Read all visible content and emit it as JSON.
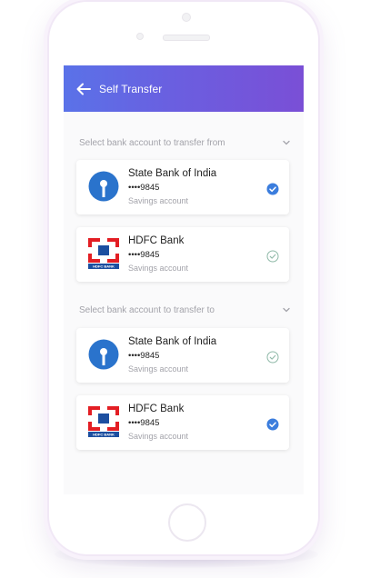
{
  "header": {
    "title": "Self Transfer"
  },
  "from_section": {
    "label": "Select  bank account to transfer from",
    "accounts": [
      {
        "bank": "State Bank of India",
        "number": "••••9845",
        "type": "Savings account",
        "selected": true,
        "logo": "sbi-logo"
      },
      {
        "bank": "HDFC Bank",
        "number": "••••9845",
        "type": "Savings account",
        "selected": false,
        "logo": "hdfc-logo",
        "logo_text": "HDFC BANK"
      }
    ]
  },
  "to_section": {
    "label": "Select  bank account to transfer to",
    "accounts": [
      {
        "bank": "State Bank of India",
        "number": "••••9845",
        "type": "Savings account",
        "selected": false,
        "logo": "sbi-logo"
      },
      {
        "bank": "HDFC Bank",
        "number": "••••9845",
        "type": "Savings account",
        "selected": true,
        "logo": "hdfc-logo",
        "logo_text": "HDFC BANK"
      }
    ]
  },
  "colors": {
    "header_start": "#5a72e8",
    "header_end": "#7a4fd6",
    "sbi_blue": "#2a73cc",
    "hdfc_red": "#e31e24",
    "hdfc_blue": "#1c4fa0",
    "check_blue": "#3b7ddd",
    "check_outline": "#8fb9a8"
  }
}
